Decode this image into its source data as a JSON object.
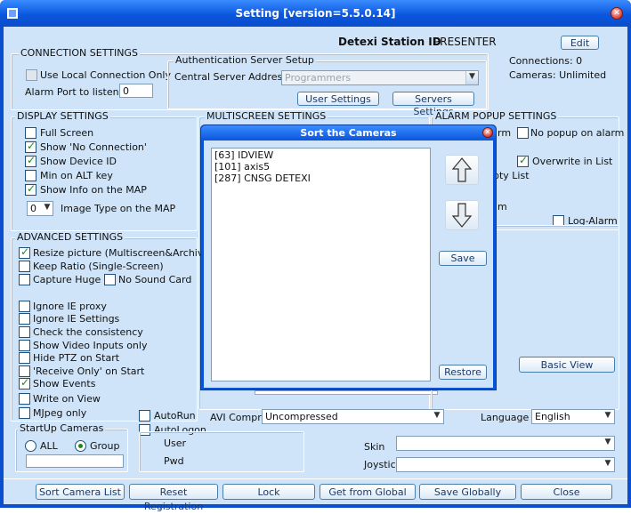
{
  "window": {
    "title": "Setting [version=5.5.0.14]"
  },
  "station": {
    "label": "Detexi Station ID",
    "value": "PRESENTER",
    "edit_label": "Edit"
  },
  "connection": {
    "title": "CONNECTION SETTINGS",
    "use_local_label": "Use Local Connection Only",
    "use_local_checked": false,
    "alarm_port_label": "Alarm Port to listen",
    "alarm_port_value": "0",
    "auth": {
      "title": "Authentication Server Setup",
      "server_label": "Central Server Address",
      "server_value": "Programmers",
      "user_settings_label": "User Settings",
      "servers_settings_label": "Servers Settings"
    },
    "connections_text": "Connections: 0",
    "cameras_text": "Cameras: Unlimited"
  },
  "display": {
    "title": "DISPLAY SETTINGS",
    "items": [
      {
        "label": "Full Screen",
        "checked": false
      },
      {
        "label": "Show 'No Connection'",
        "checked": true
      },
      {
        "label": "Show Device ID",
        "checked": true
      },
      {
        "label": "Min on ALT key",
        "checked": false
      },
      {
        "label": "Show Info on the MAP",
        "checked": true
      }
    ],
    "image_type_value": "0",
    "image_type_label": "Image Type on the MAP"
  },
  "multiscreen": {
    "title": "MULTISCREEN SETTINGS"
  },
  "alarm_popup": {
    "title": "ALARM POPUP SETTINGS",
    "partial_rm": "rm",
    "no_popup_label": "No popup on alarm",
    "overwrite_label": "Overwrite in List",
    "overwrite_checked": true,
    "partial_empty": "pty List",
    "partial_m": "m",
    "log_alarm_label": "Log-Alarm"
  },
  "advanced": {
    "title": "ADVANCED SETTINGS",
    "resize_label": "Resize picture (Multiscreen&Archive)",
    "keep_ratio_label": "Keep Ratio (Single-Screen)",
    "capture_huge_label": "Capture Huge",
    "no_sound_label": "No Sound Card",
    "items": [
      {
        "label": "Ignore IE proxy",
        "checked": false
      },
      {
        "label": "Ignore IE Settings",
        "checked": false
      },
      {
        "label": "Check the consistency",
        "checked": false
      },
      {
        "label": "Show Video Inputs  only",
        "checked": false
      },
      {
        "label": "Hide PTZ on Start",
        "checked": false
      },
      {
        "label": "'Receive Only' on Start",
        "checked": false
      },
      {
        "label": "Show Events",
        "checked": true
      },
      {
        "label": "Write on View",
        "checked": false
      },
      {
        "label": "MJpeg only",
        "checked": false
      }
    ]
  },
  "basic_view_label": "Basic View",
  "autorun_label": "AutoRun",
  "autologon_label": "AutoLogon",
  "user_label": "User",
  "pwd_label": "Pwd",
  "avi": {
    "label": "AVI Compr.",
    "value": "Uncompressed"
  },
  "language": {
    "label": "Language",
    "value": "English"
  },
  "skin_label": "Skin",
  "joystic_label": "Joystic",
  "startup": {
    "title": "StartUp Cameras",
    "all_label": "ALL",
    "group_label": "Group",
    "selected": "Group"
  },
  "bottom_buttons": [
    "Sort Camera List",
    "Reset Registration",
    "Lock",
    "Get from Global",
    "Save Globally",
    "Close"
  ],
  "sort_dialog": {
    "title": "Sort the Cameras",
    "cameras": [
      "[63] IDVIEW",
      "[101] axis5",
      "[287] CNSG DETEXI"
    ],
    "save_label": "Save",
    "restore_label": "Restore"
  }
}
